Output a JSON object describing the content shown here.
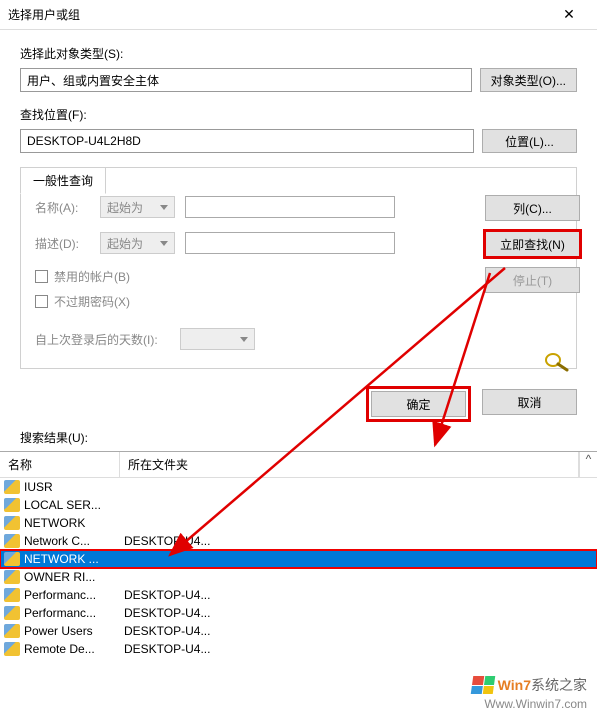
{
  "window": {
    "title": "选择用户或组"
  },
  "object_type": {
    "label": "选择此对象类型(S):",
    "value": "用户、组或内置安全主体",
    "button": "对象类型(O)..."
  },
  "location": {
    "label": "查找位置(F):",
    "value": "DESKTOP-U4L2H8D",
    "button": "位置(L)..."
  },
  "tab": {
    "label": "一般性查询"
  },
  "query": {
    "name_label": "名称(A):",
    "name_mode": "起始为",
    "desc_label": "描述(D):",
    "desc_mode": "起始为",
    "disabled_accounts": "禁用的帐户(B)",
    "non_expiring": "不过期密码(X)",
    "days_since_login": "自上次登录后的天数(I):"
  },
  "right_buttons": {
    "columns": "列(C)...",
    "find_now": "立即查找(N)",
    "stop": "停止(T)"
  },
  "dialog": {
    "ok": "确定",
    "cancel": "取消"
  },
  "results": {
    "label": "搜索结果(U):",
    "col_name": "名称",
    "col_location": "所在文件夹",
    "rows": [
      {
        "name": "IUSR",
        "location": ""
      },
      {
        "name": "LOCAL SER...",
        "location": ""
      },
      {
        "name": "NETWORK",
        "location": ""
      },
      {
        "name": "Network C...",
        "location": "DESKTOP-U4..."
      },
      {
        "name": "NETWORK ...",
        "location": "",
        "selected": true
      },
      {
        "name": "OWNER RI...",
        "location": ""
      },
      {
        "name": "Performanc...",
        "location": "DESKTOP-U4..."
      },
      {
        "name": "Performanc...",
        "location": "DESKTOP-U4..."
      },
      {
        "name": "Power Users",
        "location": "DESKTOP-U4..."
      },
      {
        "name": "Remote De...",
        "location": "DESKTOP-U4..."
      }
    ]
  },
  "watermark": {
    "brand_prefix": "Win7",
    "brand_suffix": "系统之家",
    "url": "Www.Winwin7.com"
  }
}
